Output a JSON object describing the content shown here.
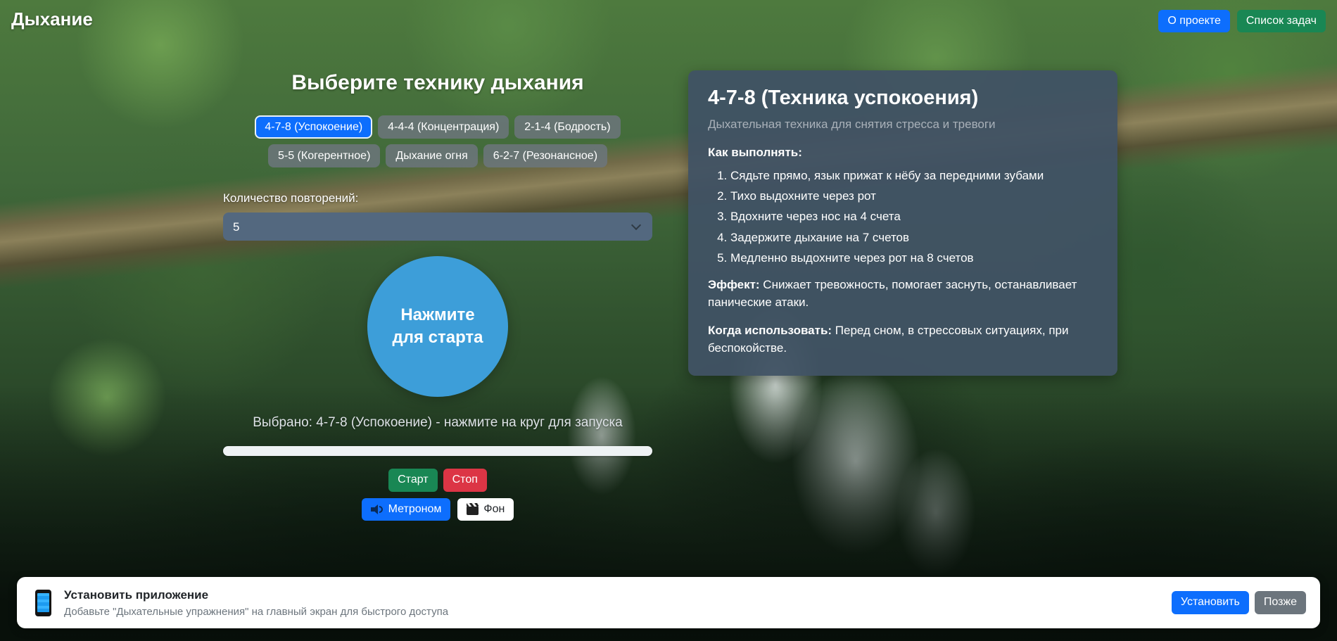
{
  "header": {
    "app_title": "Дыхание",
    "about_button": "О проекте",
    "tasks_button": "Список задач"
  },
  "selector": {
    "heading": "Выберите технику дыхания",
    "techniques": [
      {
        "label": "4-7-8 (Успокоение)",
        "selected": true
      },
      {
        "label": "4-4-4 (Концентрация)",
        "selected": false
      },
      {
        "label": "2-1-4 (Бодрость)",
        "selected": false
      },
      {
        "label": "5-5 (Когерентное)",
        "selected": false
      },
      {
        "label": "Дыхание огня",
        "selected": false
      },
      {
        "label": "6-2-7 (Резонансное)",
        "selected": false
      }
    ],
    "repetitions_label": "Количество повторений:",
    "repetitions_value": "5"
  },
  "session": {
    "circle_text_line1": "Нажмите",
    "circle_text_line2": "для старта",
    "status_text": "Выбрано: 4-7-8 (Успокоение) - нажмите на круг для запуска",
    "progress_percent": 0,
    "start_button": "Старт",
    "stop_button": "Стоп",
    "metronome_button": "Метроном",
    "metronome_icon": "speaker-icon",
    "background_button": "Фон",
    "background_icon": "clapperboard-icon"
  },
  "info_panel": {
    "title": "4-7-8 (Техника успокоения)",
    "subtitle": "Дыхательная техника для снятия стресса и тревоги",
    "how_to_label": "Как выполнять:",
    "steps": [
      "Сядьте прямо, язык прижат к нёбу за передними зубами",
      "Тихо выдохните через рот",
      "Вдохните через нос на 4 счета",
      "Задержите дыхание на 7 счетов",
      "Медленно выдохните через рот на 8 счетов"
    ],
    "effect_label": "Эффект:",
    "effect_text": " Снижает тревожность, помогает заснуть, останавливает панические атаки.",
    "when_label": "Когда использовать:",
    "when_text": " Перед сном, в стрессовых ситуациях, при беспокойстве."
  },
  "install_banner": {
    "icon": "phone-icon",
    "title": "Установить приложение",
    "subtitle": "Добавьте \"Дыхательные упражнения\" на главный экран для быстрого доступа",
    "install_button": "Установить",
    "later_button": "Позже"
  },
  "colors": {
    "accent-blue": "#0d6efd",
    "success-green": "#198754",
    "danger-red": "#dc3545",
    "secondary-gray": "#6c757d",
    "circle-blue": "#3d9ed9",
    "panel-bg": "#405264"
  }
}
